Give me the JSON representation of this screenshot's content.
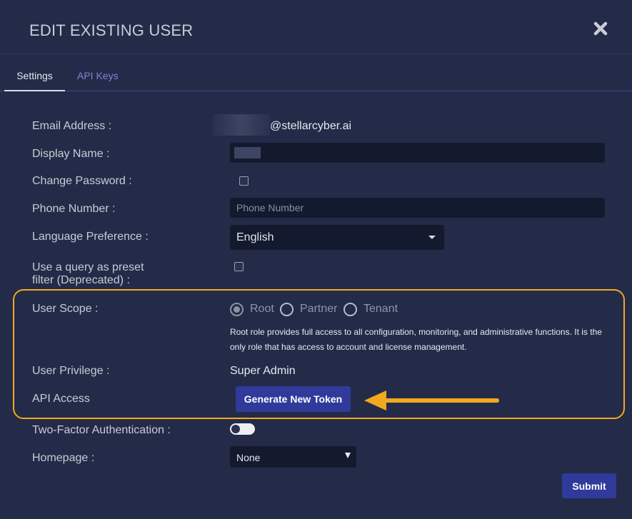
{
  "dialog": {
    "title": "EDIT EXISTING USER",
    "close_icon": "close-icon"
  },
  "tabs": [
    {
      "label": "Settings",
      "active": true
    },
    {
      "label": "API Keys",
      "active": false
    }
  ],
  "form": {
    "email": {
      "label": "Email Address :",
      "domain": "@stellarcyber.ai"
    },
    "display_name": {
      "label": "Display Name :",
      "value": ""
    },
    "change_password": {
      "label": "Change Password :",
      "checked": false
    },
    "phone": {
      "label": "Phone Number :",
      "placeholder": "Phone Number",
      "value": ""
    },
    "language": {
      "label": "Language Preference :",
      "selected": "English"
    },
    "preset_filter": {
      "label_line1": "Use a query as preset",
      "label_line2": "filter (Deprecated) :",
      "checked": false
    },
    "user_scope": {
      "label": "User Scope :",
      "options": [
        "Root",
        "Partner",
        "Tenant"
      ],
      "selected": "Root",
      "description": "Root role provides full access to all configuration, monitoring, and administrative functions. It is the only role that has access to account and license management."
    },
    "user_privilege": {
      "label": "User Privilege :",
      "value": "Super Admin"
    },
    "api_access": {
      "label": "API Access",
      "button": "Generate New Token"
    },
    "two_factor": {
      "label": "Two-Factor Authentication :",
      "enabled": false
    },
    "homepage": {
      "label": "Homepage :",
      "selected": "None"
    }
  },
  "submit_label": "Submit",
  "colors": {
    "background": "#242b48",
    "highlight": "#f2a81e",
    "primary_button": "#2f3a9a",
    "tab_accent": "#7c85d8"
  }
}
